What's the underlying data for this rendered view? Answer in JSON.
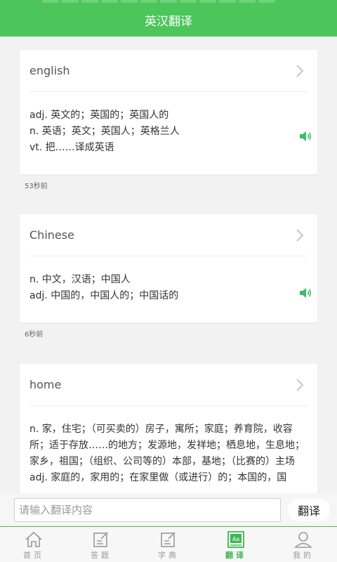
{
  "header": {
    "title": "英汉翻译"
  },
  "colors": {
    "accent": "#4cc55a",
    "speaker": "#3dbd6a"
  },
  "entries": [
    {
      "word": "english",
      "definitions": [
        "adj. 英文的；英国的；英国人的",
        "n. 英语；英文；英国人；英格兰人",
        "vt. 把……译成英语"
      ],
      "time": "53秒前",
      "icons": [
        "chevron-right-icon",
        "speaker-icon"
      ]
    },
    {
      "word": "Chinese",
      "definitions": [
        "n. 中文，汉语；中国人",
        "adj. 中国的，中国人的；中国话的"
      ],
      "time": "6秒前",
      "icons": [
        "chevron-right-icon",
        "speaker-icon"
      ]
    },
    {
      "word": "home",
      "definitions": [
        "n. 家，住宅；（可买卖的）房子，寓所；家庭；养育院，收容所；适于存放……的地方；发源地，发祥地；栖息地，生息地；家乡，祖国；（组织、公司等的）本部，基地；（比赛的）主场",
        "adj. 家庭的，家用的；在家里做（或进行）的；本国的，国"
      ],
      "icons": [
        "chevron-right-icon"
      ]
    }
  ],
  "input": {
    "placeholder": "请输入翻译内容",
    "value": ""
  },
  "translate_button": "翻译",
  "tabs": [
    {
      "label": "首页",
      "icon": "home-icon"
    },
    {
      "label": "答题",
      "icon": "edit-icon"
    },
    {
      "label": "字典",
      "icon": "dictionary-icon"
    },
    {
      "label": "翻译",
      "icon": "translate-icon",
      "active": true
    },
    {
      "label": "我的",
      "icon": "user-icon"
    }
  ]
}
